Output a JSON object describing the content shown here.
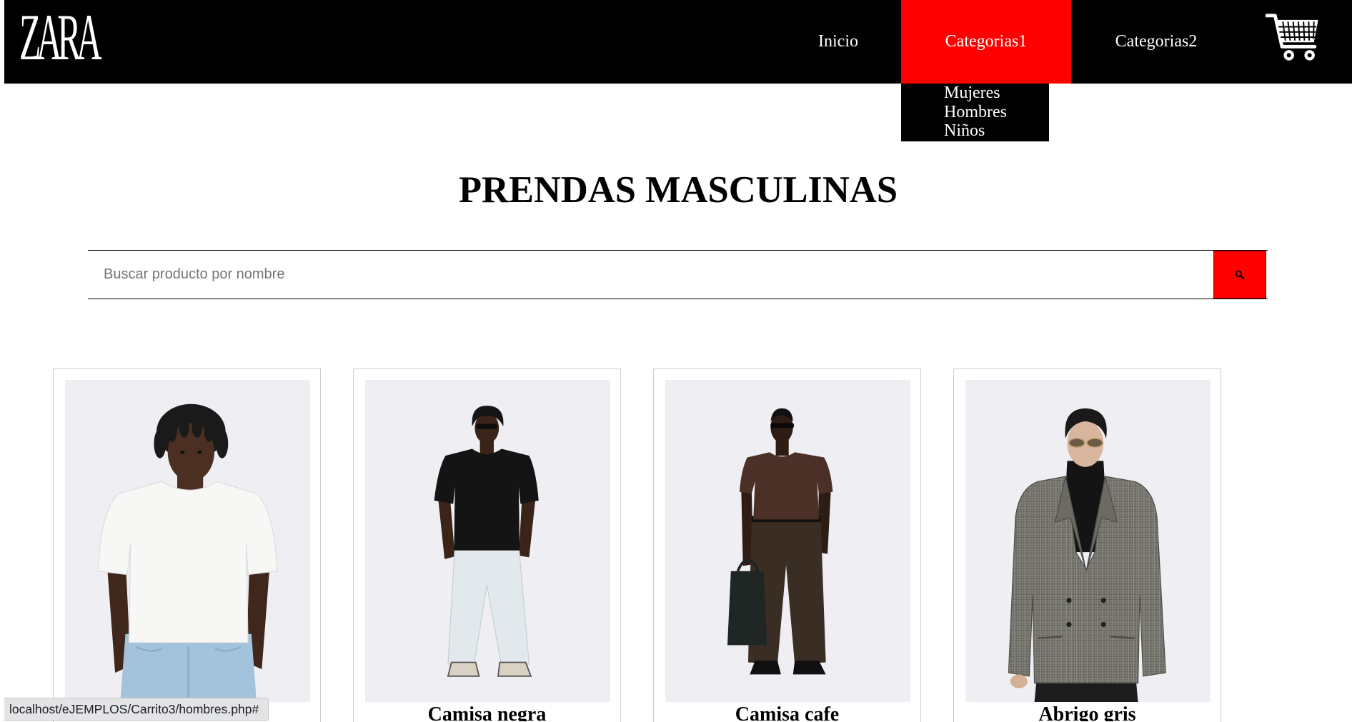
{
  "page": {
    "colors": {
      "header_bg": "#000000",
      "accent": "#ff0000",
      "text_on_dark": "#ffffff",
      "page_bg": "#ffffff",
      "title_text": "#000000"
    }
  },
  "header": {
    "logo": "ZARA",
    "nav": [
      {
        "label": "Inicio",
        "active": false
      },
      {
        "label": "Categorias1",
        "active": true
      },
      {
        "label": "Categorias2",
        "active": false
      }
    ],
    "cart_icon": "shopping-cart-icon"
  },
  "dropdown": {
    "items": [
      "Mujeres",
      "Hombres",
      "Niños"
    ]
  },
  "main": {
    "title": "PRENDAS MASCULINAS",
    "search": {
      "placeholder": "Buscar producto por nombre",
      "value": "",
      "button_icon": "search-icon"
    },
    "products": [
      {
        "name": ""
      },
      {
        "name": "Camisa negra"
      },
      {
        "name": "Camisa cafe"
      },
      {
        "name": "Abrigo gris"
      }
    ]
  },
  "status_bar": {
    "url": "localhost/eJEMPLOS/Carrito3/hombres.php#"
  }
}
